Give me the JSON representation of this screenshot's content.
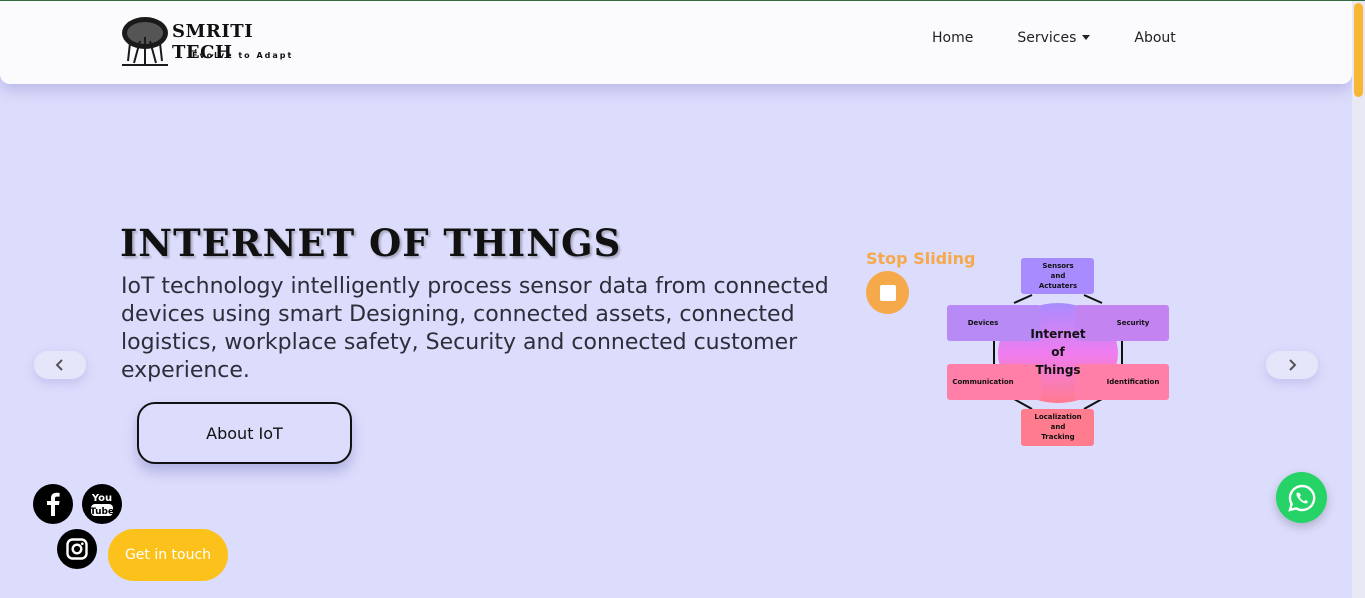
{
  "brand": {
    "name": "SMRITI TECH",
    "tagline": "Evolve to Adapt",
    "icon": "banyan-tree-logo"
  },
  "nav": {
    "items": [
      {
        "label": "Home"
      },
      {
        "label": "Services"
      },
      {
        "label": "About"
      }
    ]
  },
  "hero": {
    "title": "INTERNET OF THINGS",
    "description": "IoT technology intelligently process sensor data from connected devices using smart Designing, connected assets, connected logistics, workplace safety, Security and connected customer experience.",
    "button_label": "About IoT",
    "prev_icon": "chevron-left-icon",
    "next_icon": "chevron-right-icon"
  },
  "slider": {
    "stop_label": "Stop Sliding",
    "stop_icon": "stop-icon"
  },
  "diagram": {
    "center": [
      "Internet",
      "of",
      "Things"
    ],
    "nodes": {
      "top": [
        "Sensors",
        "and",
        "Actuaters"
      ],
      "left_top": "Devices",
      "right_top": "Security",
      "left_bottom": "Communication",
      "right_bottom": "Identification",
      "bottom": [
        "Localization",
        "and",
        "Tracking"
      ]
    }
  },
  "social": {
    "facebook_icon": "facebook-icon",
    "youtube_icon": "youtube-icon",
    "instagram_icon": "instagram-icon",
    "youtube_text": [
      "You",
      "Tube"
    ]
  },
  "cta": {
    "get_in_touch": "Get in touch"
  },
  "whatsapp": {
    "icon": "whatsapp-icon"
  },
  "colors": {
    "background": "#dcdcfc",
    "accent_orange": "#f5a94a",
    "cta_yellow": "#fcc21b",
    "whatsapp_green": "#25d366",
    "scroll_thumb": "#f7b733"
  }
}
